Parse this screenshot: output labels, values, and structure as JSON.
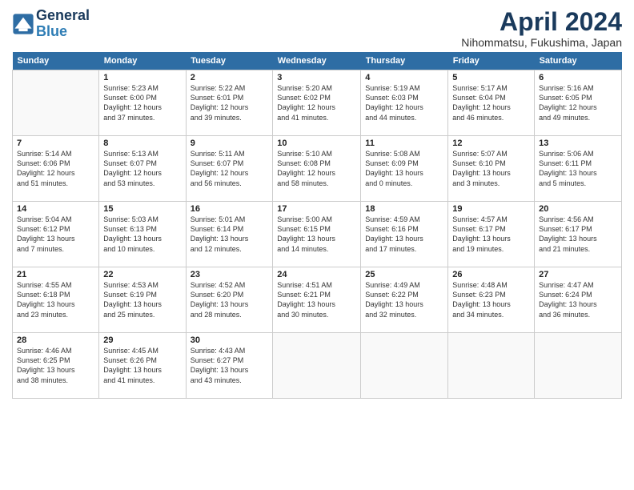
{
  "header": {
    "logo_line1": "General",
    "logo_line2": "Blue",
    "title": "April 2024",
    "location": "Nihommatsu, Fukushima, Japan"
  },
  "weekdays": [
    "Sunday",
    "Monday",
    "Tuesday",
    "Wednesday",
    "Thursday",
    "Friday",
    "Saturday"
  ],
  "weeks": [
    [
      {
        "day": "",
        "info": ""
      },
      {
        "day": "1",
        "info": "Sunrise: 5:23 AM\nSunset: 6:00 PM\nDaylight: 12 hours\nand 37 minutes."
      },
      {
        "day": "2",
        "info": "Sunrise: 5:22 AM\nSunset: 6:01 PM\nDaylight: 12 hours\nand 39 minutes."
      },
      {
        "day": "3",
        "info": "Sunrise: 5:20 AM\nSunset: 6:02 PM\nDaylight: 12 hours\nand 41 minutes."
      },
      {
        "day": "4",
        "info": "Sunrise: 5:19 AM\nSunset: 6:03 PM\nDaylight: 12 hours\nand 44 minutes."
      },
      {
        "day": "5",
        "info": "Sunrise: 5:17 AM\nSunset: 6:04 PM\nDaylight: 12 hours\nand 46 minutes."
      },
      {
        "day": "6",
        "info": "Sunrise: 5:16 AM\nSunset: 6:05 PM\nDaylight: 12 hours\nand 49 minutes."
      }
    ],
    [
      {
        "day": "7",
        "info": "Sunrise: 5:14 AM\nSunset: 6:06 PM\nDaylight: 12 hours\nand 51 minutes."
      },
      {
        "day": "8",
        "info": "Sunrise: 5:13 AM\nSunset: 6:07 PM\nDaylight: 12 hours\nand 53 minutes."
      },
      {
        "day": "9",
        "info": "Sunrise: 5:11 AM\nSunset: 6:07 PM\nDaylight: 12 hours\nand 56 minutes."
      },
      {
        "day": "10",
        "info": "Sunrise: 5:10 AM\nSunset: 6:08 PM\nDaylight: 12 hours\nand 58 minutes."
      },
      {
        "day": "11",
        "info": "Sunrise: 5:08 AM\nSunset: 6:09 PM\nDaylight: 13 hours\nand 0 minutes."
      },
      {
        "day": "12",
        "info": "Sunrise: 5:07 AM\nSunset: 6:10 PM\nDaylight: 13 hours\nand 3 minutes."
      },
      {
        "day": "13",
        "info": "Sunrise: 5:06 AM\nSunset: 6:11 PM\nDaylight: 13 hours\nand 5 minutes."
      }
    ],
    [
      {
        "day": "14",
        "info": "Sunrise: 5:04 AM\nSunset: 6:12 PM\nDaylight: 13 hours\nand 7 minutes."
      },
      {
        "day": "15",
        "info": "Sunrise: 5:03 AM\nSunset: 6:13 PM\nDaylight: 13 hours\nand 10 minutes."
      },
      {
        "day": "16",
        "info": "Sunrise: 5:01 AM\nSunset: 6:14 PM\nDaylight: 13 hours\nand 12 minutes."
      },
      {
        "day": "17",
        "info": "Sunrise: 5:00 AM\nSunset: 6:15 PM\nDaylight: 13 hours\nand 14 minutes."
      },
      {
        "day": "18",
        "info": "Sunrise: 4:59 AM\nSunset: 6:16 PM\nDaylight: 13 hours\nand 17 minutes."
      },
      {
        "day": "19",
        "info": "Sunrise: 4:57 AM\nSunset: 6:17 PM\nDaylight: 13 hours\nand 19 minutes."
      },
      {
        "day": "20",
        "info": "Sunrise: 4:56 AM\nSunset: 6:17 PM\nDaylight: 13 hours\nand 21 minutes."
      }
    ],
    [
      {
        "day": "21",
        "info": "Sunrise: 4:55 AM\nSunset: 6:18 PM\nDaylight: 13 hours\nand 23 minutes."
      },
      {
        "day": "22",
        "info": "Sunrise: 4:53 AM\nSunset: 6:19 PM\nDaylight: 13 hours\nand 25 minutes."
      },
      {
        "day": "23",
        "info": "Sunrise: 4:52 AM\nSunset: 6:20 PM\nDaylight: 13 hours\nand 28 minutes."
      },
      {
        "day": "24",
        "info": "Sunrise: 4:51 AM\nSunset: 6:21 PM\nDaylight: 13 hours\nand 30 minutes."
      },
      {
        "day": "25",
        "info": "Sunrise: 4:49 AM\nSunset: 6:22 PM\nDaylight: 13 hours\nand 32 minutes."
      },
      {
        "day": "26",
        "info": "Sunrise: 4:48 AM\nSunset: 6:23 PM\nDaylight: 13 hours\nand 34 minutes."
      },
      {
        "day": "27",
        "info": "Sunrise: 4:47 AM\nSunset: 6:24 PM\nDaylight: 13 hours\nand 36 minutes."
      }
    ],
    [
      {
        "day": "28",
        "info": "Sunrise: 4:46 AM\nSunset: 6:25 PM\nDaylight: 13 hours\nand 38 minutes."
      },
      {
        "day": "29",
        "info": "Sunrise: 4:45 AM\nSunset: 6:26 PM\nDaylight: 13 hours\nand 41 minutes."
      },
      {
        "day": "30",
        "info": "Sunrise: 4:43 AM\nSunset: 6:27 PM\nDaylight: 13 hours\nand 43 minutes."
      },
      {
        "day": "",
        "info": ""
      },
      {
        "day": "",
        "info": ""
      },
      {
        "day": "",
        "info": ""
      },
      {
        "day": "",
        "info": ""
      }
    ]
  ]
}
